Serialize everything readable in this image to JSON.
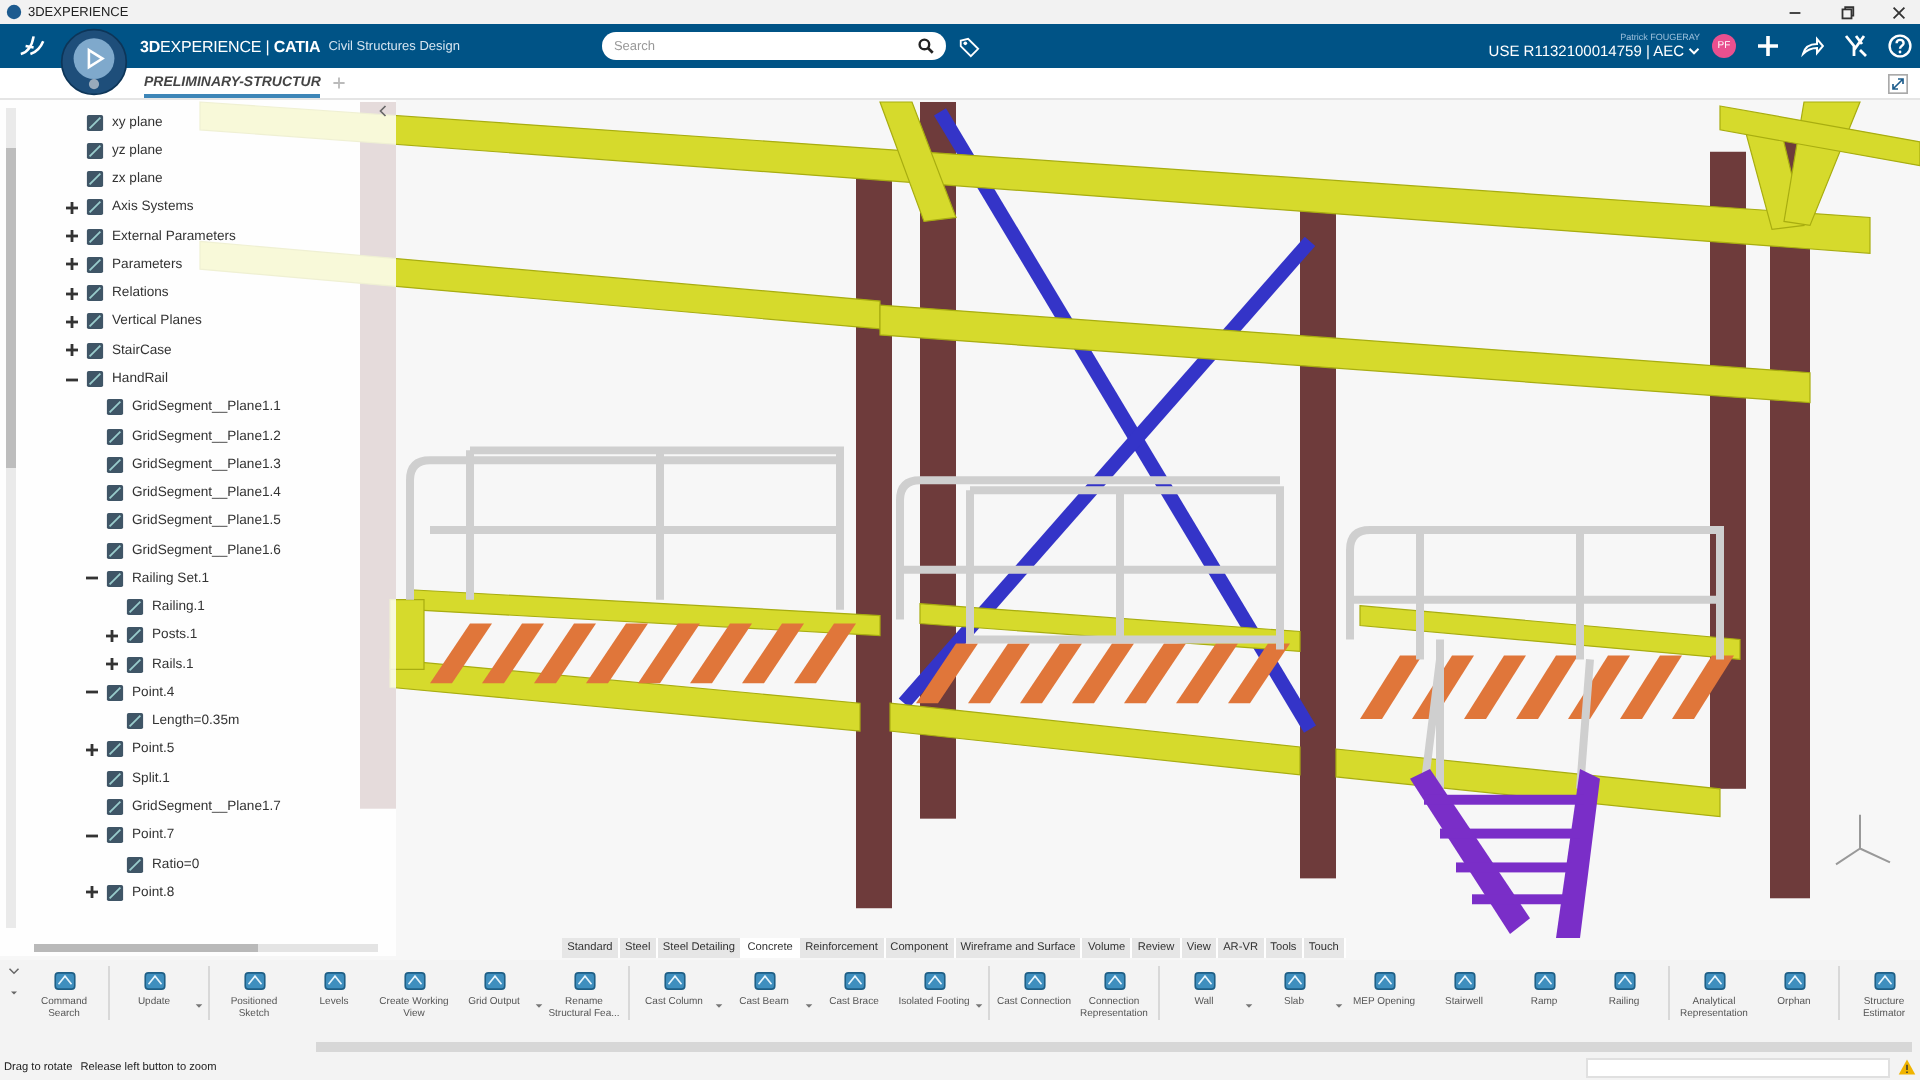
{
  "window": {
    "title": "3DEXPERIENCE"
  },
  "header": {
    "brand": "**3D**EXPERIENCE | **CATIA**",
    "app": "Civil Structures Design",
    "search": {
      "placeholder": "Search"
    },
    "user_name": "Patrick FOUGERAY",
    "context": "USE R1132100014759 | AEC",
    "avatar": "PF"
  },
  "document_tabs": [
    {
      "label": "PRELIMINARY-STRUCTUR",
      "selected": true
    }
  ],
  "tree": [
    {
      "label": "xy plane"
    },
    {
      "label": "yz plane"
    },
    {
      "label": "zx plane"
    },
    {
      "label": "Axis Systems",
      "expanded": false
    },
    {
      "label": "External Parameters",
      "expanded": false
    },
    {
      "label": "Parameters",
      "expanded": false
    },
    {
      "label": "Relations",
      "expanded": false
    },
    {
      "label": "Vertical Planes",
      "expanded": false
    },
    {
      "label": "StairCase",
      "expanded": false
    },
    {
      "label": "HandRail",
      "expanded": true,
      "children": [
        {
          "label": "GridSegment__Plane1.1"
        },
        {
          "label": "GridSegment__Plane1.2"
        },
        {
          "label": "GridSegment__Plane1.3"
        },
        {
          "label": "GridSegment__Plane1.4"
        },
        {
          "label": "GridSegment__Plane1.5"
        },
        {
          "label": "GridSegment__Plane1.6"
        },
        {
          "label": "Railing Set.1",
          "expanded": true,
          "children": [
            {
              "label": "Railing.1"
            },
            {
              "label": "Posts.1",
              "expanded": false
            },
            {
              "label": "Rails.1",
              "expanded": false
            }
          ]
        },
        {
          "label": "Point.4",
          "expanded": true,
          "children": [
            {
              "label": "Length=0.35m"
            }
          ]
        },
        {
          "label": "Point.5",
          "expanded": false
        },
        {
          "label": "Split.1"
        },
        {
          "label": "GridSegment__Plane1.7"
        },
        {
          "label": "Point.7",
          "expanded": true,
          "children": [
            {
              "label": "Ratio=0"
            }
          ]
        },
        {
          "label": "Point.8",
          "expanded": false
        }
      ]
    }
  ],
  "ribbon_tabs": [
    {
      "label": "Standard",
      "selected": false
    },
    {
      "label": "Steel",
      "selected": false
    },
    {
      "label": "Steel Detailing",
      "selected": false
    },
    {
      "label": "Concrete",
      "selected": true
    },
    {
      "label": "Reinforcement",
      "selected": false
    },
    {
      "label": "Component",
      "selected": false
    },
    {
      "label": "Wireframe and Surface",
      "selected": false
    },
    {
      "label": "Volume",
      "selected": false
    },
    {
      "label": "Review",
      "selected": false
    },
    {
      "label": "View",
      "selected": false
    },
    {
      "label": "AR-VR",
      "selected": false
    },
    {
      "label": "Tools",
      "selected": false
    },
    {
      "label": "Touch",
      "selected": false
    }
  ],
  "toolbar_groups": [
    [
      {
        "label": "Command Search",
        "menu": false
      }
    ],
    [
      {
        "label": "Update",
        "menu": true
      }
    ],
    [
      {
        "label": "Positioned Sketch",
        "menu": false
      },
      {
        "label": "Levels",
        "menu": false
      },
      {
        "label": "Create Working View",
        "menu": false
      },
      {
        "label": "Grid Output",
        "menu": true
      },
      {
        "label": "Rename Structural Fea...",
        "menu": false
      }
    ],
    [
      {
        "label": "Cast Column",
        "menu": true
      },
      {
        "label": "Cast Beam",
        "menu": true
      },
      {
        "label": "Cast Brace",
        "menu": false
      },
      {
        "label": "Isolated Footing",
        "menu": true
      }
    ],
    [
      {
        "label": "Cast Connection",
        "menu": false
      },
      {
        "label": "Connection Representation",
        "menu": false
      }
    ],
    [
      {
        "label": "Wall",
        "menu": true
      },
      {
        "label": "Slab",
        "menu": true
      },
      {
        "label": "MEP Opening",
        "menu": false
      },
      {
        "label": "Stairwell",
        "menu": false
      },
      {
        "label": "Ramp",
        "menu": false
      },
      {
        "label": "Railing",
        "menu": false
      }
    ],
    [
      {
        "label": "Analytical Representation",
        "menu": false
      },
      {
        "label": "Orphan",
        "menu": false
      }
    ],
    [
      {
        "label": "Structure Estimator",
        "menu": false
      }
    ]
  ],
  "status_bar": {
    "messages": [
      "Drag to rotate",
      "Release left button to zoom"
    ]
  }
}
